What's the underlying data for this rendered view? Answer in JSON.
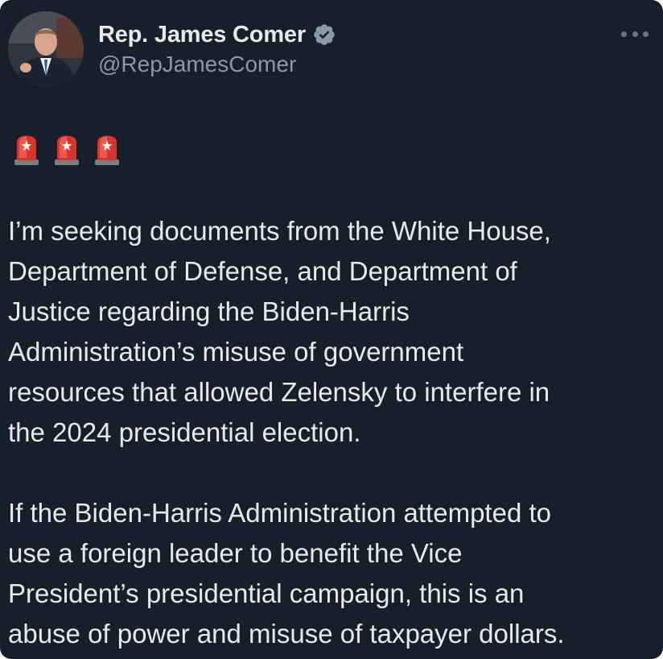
{
  "tweet": {
    "author": {
      "display_name": "Rep. James Comer",
      "handle": "@RepJamesComer",
      "verified_icon": "verified-badge-icon",
      "avatar": "profile-photo"
    },
    "more_icon": "more-options-icon",
    "emoji_row": [
      "🚨",
      "🚨",
      "🚨"
    ],
    "paragraphs": [
      "I’m seeking documents from the White House,\nDepartment of Defense, and Department of\nJustice regarding the Biden-Harris\nAdministration’s misuse of government\nresources that allowed Zelensky to interfere in\nthe 2024 presidential election.",
      "If the Biden-Harris Administration attempted to\nuse a foreign leader to benefit the Vice\nPresident’s presidential campaign, this is an\nabuse of power and misuse of taxpayer dollars."
    ]
  },
  "colors": {
    "background": "#15202b",
    "text": "#e7e9ea",
    "secondary_text": "#8b98a5",
    "verified_badge": "#8b98a5",
    "siren_red": "#e0312c"
  }
}
